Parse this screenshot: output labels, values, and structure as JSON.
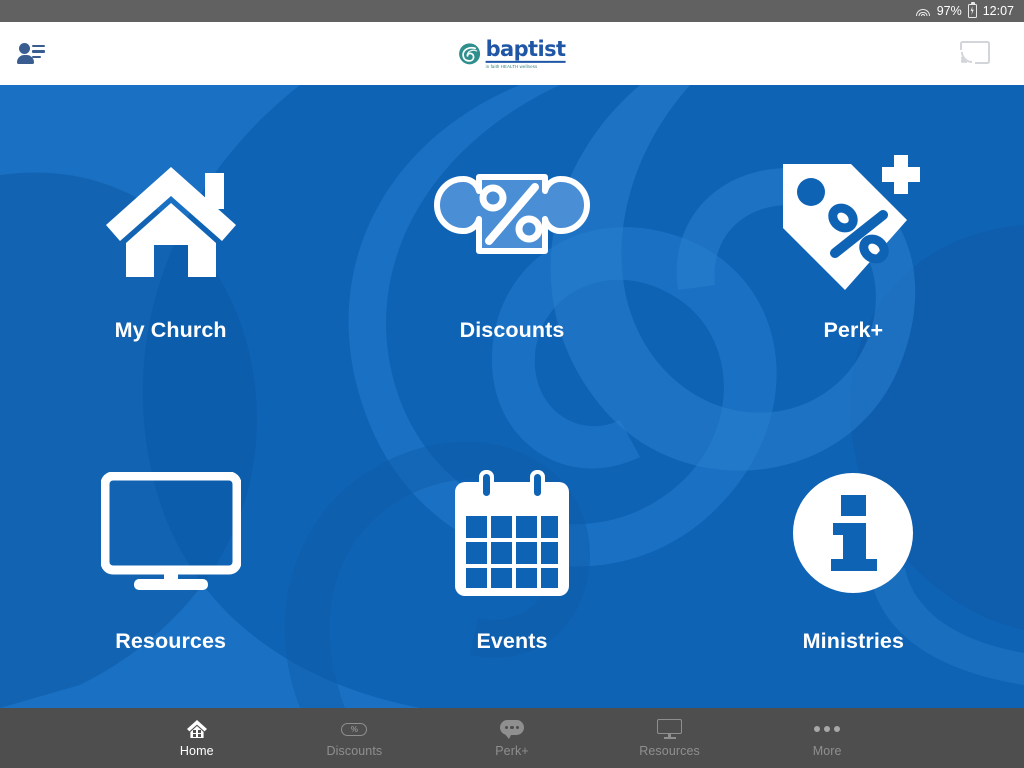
{
  "status_bar": {
    "wifi_icon": "wifi-icon",
    "battery_percent": "97%",
    "battery_icon": "battery-charging-icon",
    "time": "12:07"
  },
  "header": {
    "contacts_icon": "contacts-icon",
    "logo": {
      "swirl_icon": "baptist-swirl-logo-icon",
      "name": "baptist",
      "tagline": "in faith HEALTH wellness"
    },
    "cast_icon": "cast-icon"
  },
  "main": {
    "background_color": "#0f63b5",
    "tiles": [
      {
        "id": "my-church",
        "label": "My Church",
        "icon": "house-icon"
      },
      {
        "id": "discounts",
        "label": "Discounts",
        "icon": "coupon-percent-icon"
      },
      {
        "id": "perk-plus",
        "label": "Perk+",
        "icon": "price-tag-plus-icon"
      },
      {
        "id": "resources",
        "label": "Resources",
        "icon": "monitor-icon"
      },
      {
        "id": "events",
        "label": "Events",
        "icon": "calendar-icon"
      },
      {
        "id": "ministries",
        "label": "Ministries",
        "icon": "info-circle-icon"
      }
    ]
  },
  "bottom_nav": {
    "background_color": "#4e4e4e",
    "active_color": "#ffffff",
    "inactive_color": "#8f8f8f",
    "items": [
      {
        "id": "home",
        "label": "Home",
        "icon": "home-icon",
        "active": true
      },
      {
        "id": "discounts",
        "label": "Discounts",
        "icon": "discount-tag-icon",
        "active": false
      },
      {
        "id": "perk",
        "label": "Perk+",
        "icon": "chat-bubble-icon",
        "active": false
      },
      {
        "id": "resources",
        "label": "Resources",
        "icon": "monitor-icon",
        "active": false
      },
      {
        "id": "more",
        "label": "More",
        "icon": "ellipsis-icon",
        "active": false
      }
    ]
  }
}
